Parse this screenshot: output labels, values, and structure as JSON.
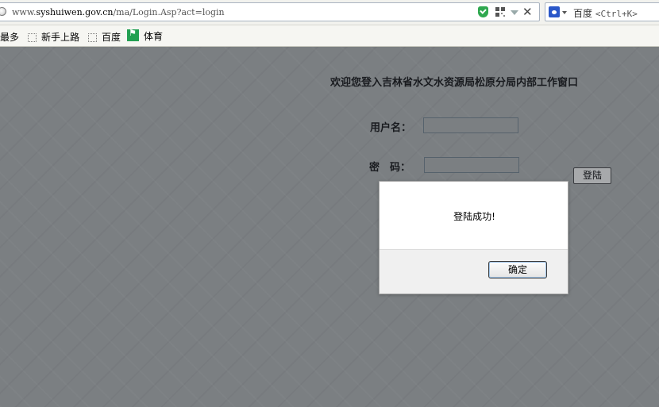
{
  "browser": {
    "url_prefix": "www.",
    "url_domain": "syshuiwen.gov.cn",
    "url_path": "/ma/Login.Asp?act=login",
    "search_engine": "百度",
    "search_hint": "<Ctrl+K>",
    "icons": [
      "globe-icon",
      "shield-icon",
      "qr-code-icon",
      "dropdown-icon",
      "close-icon",
      "baidu-paw-icon"
    ]
  },
  "bookmarks": {
    "items": [
      {
        "label": "访问最多"
      },
      {
        "label": "新手上路"
      },
      {
        "label": "百度"
      },
      {
        "label": "体育"
      }
    ]
  },
  "page": {
    "welcome": "欢迎您登入吉林省水文水资源局松原分局内部工作窗口",
    "username_label": "用户名：",
    "username_value": "",
    "password_label": "密　码：",
    "password_value": "",
    "login_button": "登陆"
  },
  "dialog": {
    "message": "登陆成功!",
    "ok_button": "确定"
  },
  "colors": {
    "page_bg": "#a8abaa",
    "overlay": "rgba(40,46,56,0.35)",
    "shield_green": "#2fa84f",
    "baidu_blue": "#2a57c9"
  }
}
